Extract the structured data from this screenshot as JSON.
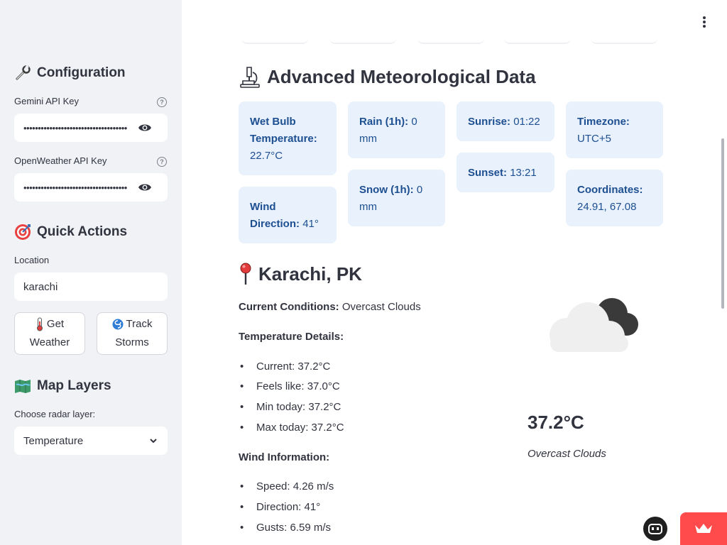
{
  "sidebar": {
    "configuration_title": "Configuration",
    "gemini_label": "Gemini API Key",
    "gemini_value": "•••••••••••••••••••••••••••••••••••••",
    "openweather_label": "OpenWeather API Key",
    "openweather_value": "•••••••••••••••••••••••••••••••••••••",
    "quick_actions_title": "Quick Actions",
    "location_label": "Location",
    "location_value": "karachi",
    "get_weather_line1": "Get",
    "get_weather_line2": "Weather",
    "track_storms_line1": "Track",
    "track_storms_line2": "Storms",
    "map_layers_title": "Map Layers",
    "radar_label": "Choose radar layer:",
    "radar_value": "Temperature"
  },
  "main": {
    "advanced_title": "Advanced Meteorological Data",
    "cards": {
      "wet_bulb_label": "Wet Bulb Temperature:",
      "wet_bulb_value": "22.7°C",
      "wind_dir_label": "Wind Direction:",
      "wind_dir_value": "41°",
      "rain_label": "Rain (1h):",
      "rain_value": "0 mm",
      "snow_label": "Snow (1h):",
      "snow_value": "0 mm",
      "sunrise_label": "Sunrise:",
      "sunrise_value": "01:22",
      "sunset_label": "Sunset:",
      "sunset_value": "13:21",
      "timezone_label": "Timezone:",
      "timezone_value": "UTC+5",
      "coords_label": "Coordinates:",
      "coords_value": "24.91, 67.08"
    },
    "city_title": "Karachi, PK",
    "current_conditions_label": "Current Conditions:",
    "current_conditions_value": "Overcast Clouds",
    "temp_details_label": "Temperature Details:",
    "temp_items": [
      "Current: 37.2°C",
      "Feels like: 37.0°C",
      "Min today: 37.2°C",
      "Max today: 37.2°C"
    ],
    "wind_info_label": "Wind Information:",
    "wind_items": [
      "Speed: 4.26 m/s",
      "Direction: 41°",
      "Gusts: 6.59 m/s"
    ],
    "big_temp": "37.2°C",
    "big_condition": "Overcast Clouds"
  },
  "colors": {
    "card_bg": "#e8f1fc",
    "card_text": "#1d4f91",
    "sidebar_bg": "#f0f2f6",
    "accent": "#ff4b4b"
  },
  "icons": [
    "wrench-icon",
    "help-icon",
    "eye-icon",
    "target-icon",
    "thermometer-icon",
    "cyclone-icon",
    "map-icon",
    "chevron-down-icon",
    "microscope-icon",
    "pushpin-icon",
    "cloud-icon",
    "kebab-menu-icon",
    "bot-badge-icon",
    "crown-icon"
  ]
}
